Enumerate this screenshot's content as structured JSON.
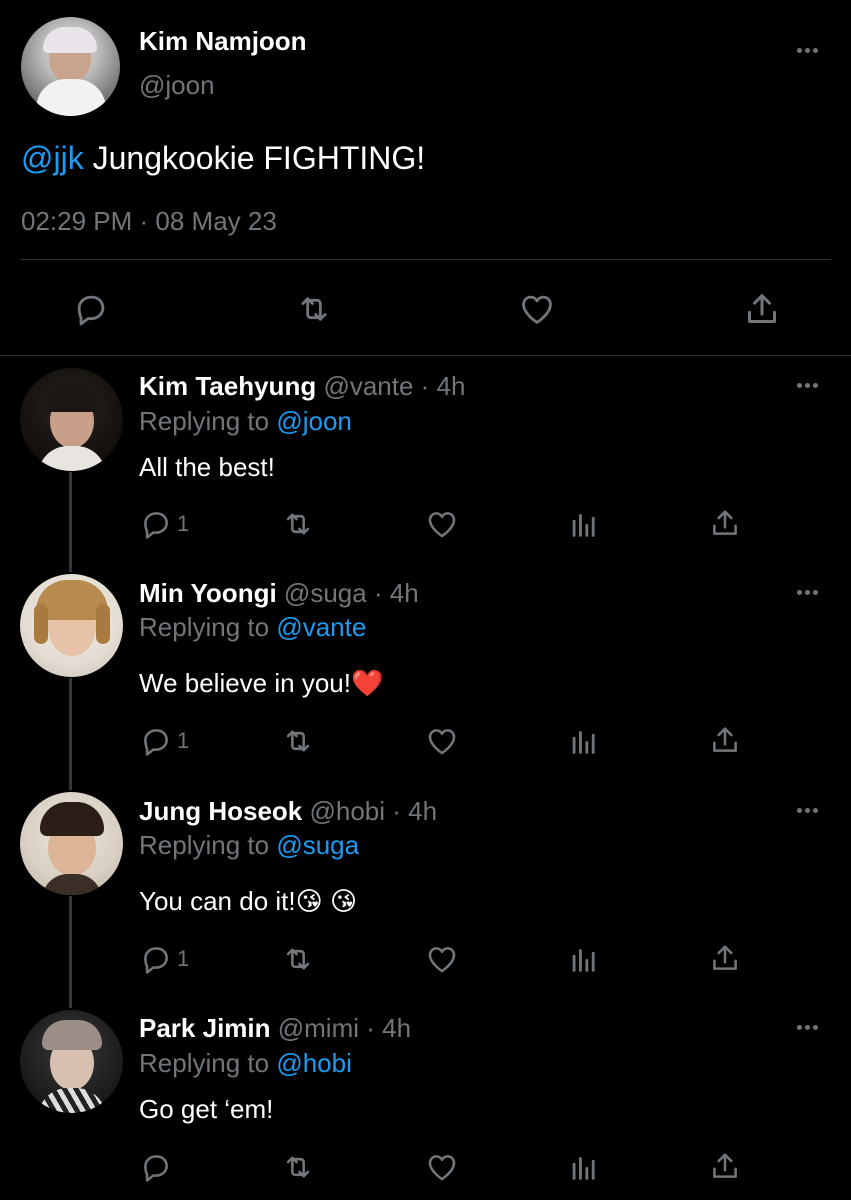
{
  "main_tweet": {
    "author_name": "Kim Namjoon",
    "author_handle": "@joon",
    "mention": "@jjk",
    "text": " Jungkookie FIGHTING!",
    "timestamp": "02:29 PM · 08 May 23"
  },
  "replies": [
    {
      "name": "Kim Taehyung",
      "meta": "@vante · 4h",
      "replying_label": "Replying to ",
      "replying_handle": "@joon",
      "text": "All the best!",
      "reply_count": "1"
    },
    {
      "name": "Min Yoongi",
      "meta": "@suga · 4h",
      "replying_label": "Replying to ",
      "replying_handle": "@vante",
      "text": "We believe in you!❤️",
      "reply_count": "1"
    },
    {
      "name": "Jung Hoseok",
      "meta": "@hobi · 4h",
      "replying_label": "Replying to ",
      "replying_handle": "@suga",
      "text": "You can do it!😘 😘",
      "reply_count": "1"
    },
    {
      "name": "Park Jimin",
      "meta": "@mimi · 4h",
      "replying_label": "Replying to ",
      "replying_handle": "@hobi",
      "text": "Go get ‘em!",
      "reply_count": ""
    }
  ],
  "colors": {
    "background": "#000000",
    "accent": "#1d9bf0",
    "muted": "#71767b",
    "divider": "#2f3336"
  },
  "icons": [
    "more-icon",
    "reply-icon",
    "retweet-icon",
    "like-icon",
    "share-icon",
    "analytics-icon"
  ]
}
